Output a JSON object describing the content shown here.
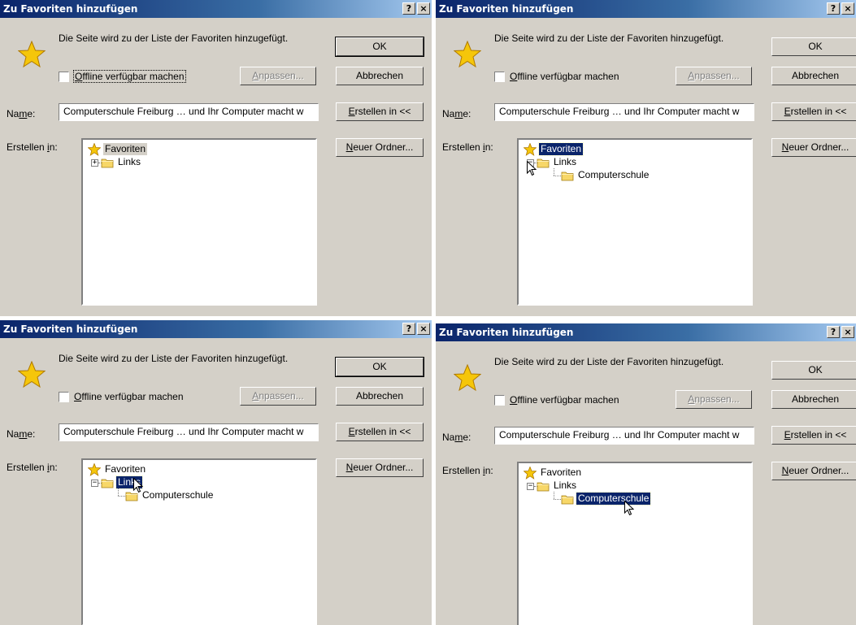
{
  "dialogs": [
    {
      "title": "Zu Favoriten hinzufügen",
      "help_button": "?",
      "close_button": "×",
      "info_text": "Die Seite wird zu der Liste der Favoriten hinzugefügt.",
      "offline_checkbox": {
        "label": "Offline verfügbar machen",
        "checked": false
      },
      "customize_button": "Anpassen...",
      "ok_button": "OK",
      "cancel_button": "Abbrechen",
      "name_label": "Name:",
      "name_value": "Computerschule Freiburg … und Ihr Computer macht w",
      "create_in_button": "Erstellen in <<",
      "create_in_label": "Erstellen in:",
      "new_folder_button": "Neuer Ordner...",
      "tree": {
        "root": "Favoriten",
        "child": "Links",
        "grandchild": "",
        "selected": "Favoriten",
        "expanded": false
      }
    },
    {
      "title": "Zu Favoriten hinzufügen",
      "help_button": "?",
      "close_button": "×",
      "info_text": "Die Seite wird zu der Liste der Favoriten hinzugefügt.",
      "offline_checkbox": {
        "label": "Offline verfügbar machen",
        "checked": false
      },
      "customize_button": "Anpassen...",
      "ok_button": "OK",
      "cancel_button": "Abbrechen",
      "name_label": "Name:",
      "name_value": "Computerschule Freiburg … und Ihr Computer macht w",
      "create_in_button": "Erstellen in <<",
      "create_in_label": "Erstellen in:",
      "new_folder_button": "Neuer Ordner...",
      "tree": {
        "root": "Favoriten",
        "child": "Links",
        "grandchild": "Computerschule",
        "selected": "Favoriten",
        "expanded": true
      }
    },
    {
      "title": "Zu Favoriten hinzufügen",
      "help_button": "?",
      "close_button": "×",
      "info_text": "Die Seite wird zu der Liste der Favoriten hinzugefügt.",
      "offline_checkbox": {
        "label": "Offline verfügbar machen",
        "checked": false
      },
      "customize_button": "Anpassen...",
      "ok_button": "OK",
      "cancel_button": "Abbrechen",
      "name_label": "Name:",
      "name_value": "Computerschule Freiburg … und Ihr Computer macht w",
      "create_in_button": "Erstellen in <<",
      "create_in_label": "Erstellen in:",
      "new_folder_button": "Neuer Ordner...",
      "tree": {
        "root": "Favoriten",
        "child": "Links",
        "grandchild": "Computerschule",
        "selected": "Links",
        "expanded": true
      }
    },
    {
      "title": "Zu Favoriten hinzufügen",
      "help_button": "?",
      "close_button": "×",
      "info_text": "Die Seite wird zu der Liste der Favoriten hinzugefügt.",
      "offline_checkbox": {
        "label": "Offline verfügbar machen",
        "checked": false
      },
      "customize_button": "Anpassen...",
      "ok_button": "OK",
      "cancel_button": "Abbrechen",
      "name_label": "Name:",
      "name_value": "Computerschule Freiburg … und Ihr Computer macht w",
      "create_in_button": "Erstellen in <<",
      "create_in_label": "Erstellen in:",
      "new_folder_button": "Neuer Ordner...",
      "tree": {
        "root": "Favoriten",
        "child": "Links",
        "grandchild": "Computerschule",
        "selected": "Computerschule",
        "expanded": true
      }
    }
  ],
  "colors": {
    "dialog_face": "#d4d0c8",
    "titlebar_start": "#0a246a",
    "titlebar_end": "#a6caf0",
    "selection": "#0a246a",
    "star": "#f5c60a",
    "folder": "#f7d768"
  },
  "icons": {
    "dialog": "favorites-star-icon",
    "tree_root": "favorites-star-icon",
    "tree_folder": "folder-icon",
    "pointer": "mouse-pointer-icon"
  }
}
